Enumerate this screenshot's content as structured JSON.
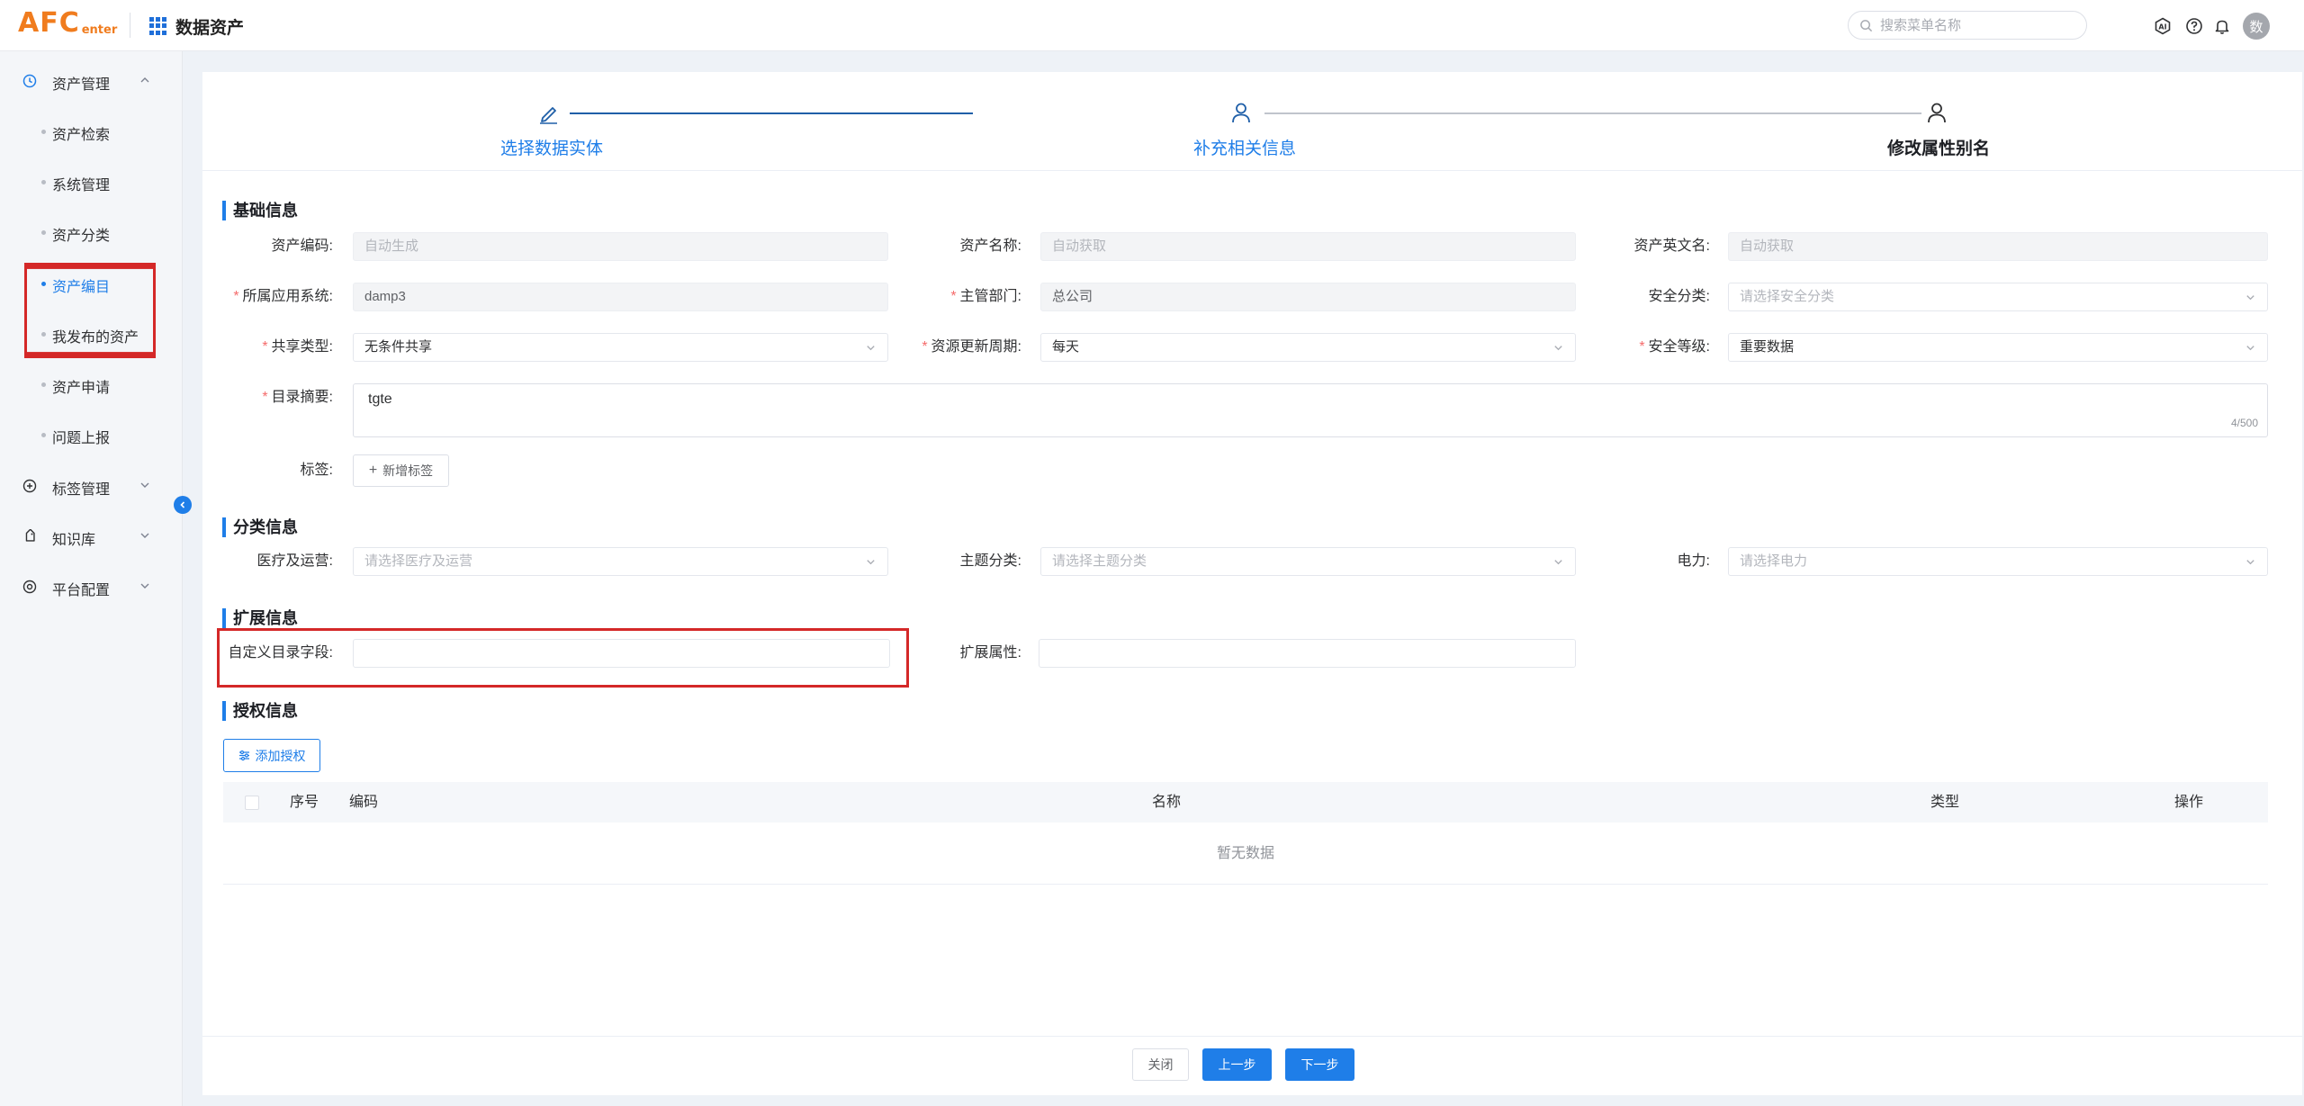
{
  "header": {
    "logo_main": "AFC",
    "logo_sub": "enter",
    "app_title": "数据资产",
    "search_placeholder": "搜索菜单名称",
    "avatar_text": "数"
  },
  "sidebar": {
    "groups": [
      {
        "label": "资产管理",
        "icon": "clock-icon",
        "expanded": true
      },
      {
        "label": "标签管理",
        "icon": "plus-circle-icon",
        "expanded": false
      },
      {
        "label": "知识库",
        "icon": "tag-icon",
        "expanded": false
      },
      {
        "label": "平台配置",
        "icon": "target-icon",
        "expanded": false
      }
    ],
    "sub_items": [
      {
        "label": "资产检索"
      },
      {
        "label": "系统管理"
      },
      {
        "label": "资产分类"
      },
      {
        "label": "资产编目",
        "active": true
      },
      {
        "label": "我发布的资产"
      },
      {
        "label": "资产申请"
      },
      {
        "label": "问题上报"
      }
    ]
  },
  "steps": [
    {
      "label": "选择数据实体",
      "state": "done"
    },
    {
      "label": "补充相关信息",
      "state": "done"
    },
    {
      "label": "修改属性别名",
      "state": "current"
    }
  ],
  "sections": {
    "basic": "基础信息",
    "category": "分类信息",
    "extension": "扩展信息",
    "auth": "授权信息"
  },
  "form": {
    "asset_code": {
      "label": "资产编码:",
      "placeholder": "自动生成"
    },
    "asset_name": {
      "label": "资产名称:",
      "placeholder": "自动获取"
    },
    "asset_en_name": {
      "label": "资产英文名:",
      "placeholder": "自动获取"
    },
    "app_system": {
      "label": "所属应用系统:",
      "value": "damp3"
    },
    "department": {
      "label": "主管部门:",
      "value": "总公司"
    },
    "security_class": {
      "label": "安全分类:",
      "placeholder": "请选择安全分类"
    },
    "share_type": {
      "label": "共享类型:",
      "value": "无条件共享"
    },
    "update_cycle": {
      "label": "资源更新周期:",
      "value": "每天"
    },
    "security_level": {
      "label": "安全等级:",
      "value": "重要数据"
    },
    "summary": {
      "label": "目录摘要:",
      "value": "tgte",
      "counter": "4/500"
    },
    "tags": {
      "label": "标签:",
      "button": "新增标签"
    },
    "medical": {
      "label": "医疗及运营:",
      "placeholder": "请选择医疗及运营"
    },
    "topic": {
      "label": "主题分类:",
      "placeholder": "请选择主题分类"
    },
    "power": {
      "label": "电力:",
      "placeholder": "请选择电力"
    },
    "custom_field": {
      "label": "自定义目录字段:",
      "value": ""
    },
    "ext_attr": {
      "label": "扩展属性:",
      "value": ""
    }
  },
  "auth": {
    "add_button": "添加授权",
    "columns": [
      "序号",
      "编码",
      "名称",
      "类型",
      "操作"
    ],
    "empty_text": "暂无数据"
  },
  "footer": {
    "close": "关闭",
    "prev": "上一步",
    "next": "下一步"
  },
  "colors": {
    "accent": "#1f7ee8",
    "highlight_box": "#d42828",
    "logo": "#f07c1e"
  }
}
